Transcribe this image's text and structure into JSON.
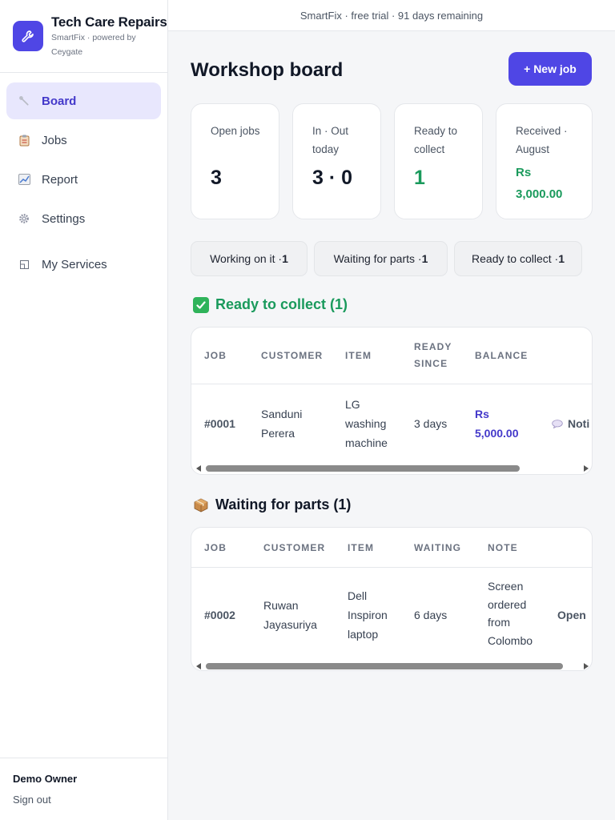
{
  "brand": {
    "name": "Tech Care Repairs",
    "subtitle": "SmartFix · powered by Ceygate",
    "logo_icon": "wrench-icon"
  },
  "banner": "SmartFix · free trial · 91 days remaining",
  "nav": [
    {
      "label": "Board",
      "icon": "wrench-icon",
      "active": true
    },
    {
      "label": "Jobs",
      "icon": "clipboard-icon",
      "active": false
    },
    {
      "label": "Report",
      "icon": "chart-icon",
      "active": false
    },
    {
      "label": "Settings",
      "icon": "gear-icon",
      "active": false
    },
    {
      "label": "My Services",
      "icon": "window-icon",
      "active": false
    }
  ],
  "footer": {
    "owner": "Demo Owner",
    "sign_out": "Sign out"
  },
  "page": {
    "title": "Workshop board",
    "new_job_label": "+ New job"
  },
  "stats": [
    {
      "label": "Open jobs",
      "value": "3"
    },
    {
      "label": "In · Out today",
      "value": "3 · 0"
    },
    {
      "label": "Ready to collect",
      "value": "1"
    },
    {
      "label": "Received · August",
      "value": "Rs 3,000.00"
    }
  ],
  "chips": [
    {
      "label": "Working on it · ",
      "count": "1"
    },
    {
      "label": "Waiting for parts · ",
      "count": "1"
    },
    {
      "label": "Ready to collect · ",
      "count": "1"
    }
  ],
  "ready_section": {
    "title": "Ready to collect (1)",
    "icon": "checkmark-box-icon",
    "headers": [
      "JOB",
      "CUSTOMER",
      "ITEM",
      "READY SINCE",
      "BALANCE"
    ],
    "rows": [
      {
        "job": "#0001",
        "customer": "Sanduni Perera",
        "item": "LG washing machine",
        "since": "3 days",
        "balance": "Rs 5,000.00",
        "action": "Noti"
      }
    ]
  },
  "waiting_section": {
    "title": "Waiting for parts (1)",
    "icon": "package-icon",
    "headers": [
      "JOB",
      "CUSTOMER",
      "ITEM",
      "WAITING",
      "NOTE"
    ],
    "rows": [
      {
        "job": "#0002",
        "customer": "Ruwan Jayasuriya",
        "item": "Dell Inspiron laptop",
        "waiting": "6 days",
        "note": "Screen ordered from Colombo",
        "action": "Open"
      }
    ]
  },
  "colors": {
    "accent": "#4f46e5",
    "green": "#1a9a5c",
    "balance": "#4338ca"
  }
}
